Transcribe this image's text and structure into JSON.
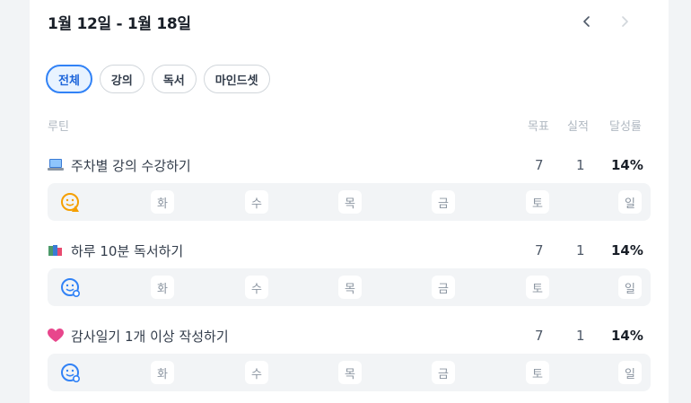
{
  "header": {
    "title": "1월 12일 - 1월 18일"
  },
  "tabs": [
    {
      "label": "전체",
      "active": true
    },
    {
      "label": "강의",
      "active": false
    },
    {
      "label": "독서",
      "active": false
    },
    {
      "label": "마인드셋",
      "active": false
    }
  ],
  "columns": {
    "routine": "루틴",
    "goal": "목표",
    "actual": "실적",
    "rate": "달성률"
  },
  "colors": {
    "accent": "#3182f6",
    "orange": "#f59f00",
    "blue": "#3182f6"
  },
  "routines": [
    {
      "icon": "laptop-icon",
      "name": "주차별 강의 수강하기",
      "goal": "7",
      "actual": "1",
      "rate": "14%",
      "days": [
        "화",
        "수",
        "목",
        "금",
        "토",
        "일"
      ],
      "face": "warning-face-icon"
    },
    {
      "icon": "books-icon",
      "name": "하루 10분 독서하기",
      "goal": "7",
      "actual": "1",
      "rate": "14%",
      "days": [
        "화",
        "수",
        "목",
        "금",
        "토",
        "일"
      ],
      "face": "smile-face-icon"
    },
    {
      "icon": "heart-icon",
      "name": "감사일기 1개 이상 작성하기",
      "goal": "7",
      "actual": "1",
      "rate": "14%",
      "days": [
        "화",
        "수",
        "목",
        "금",
        "토",
        "일"
      ],
      "face": "smile-face-icon"
    }
  ]
}
